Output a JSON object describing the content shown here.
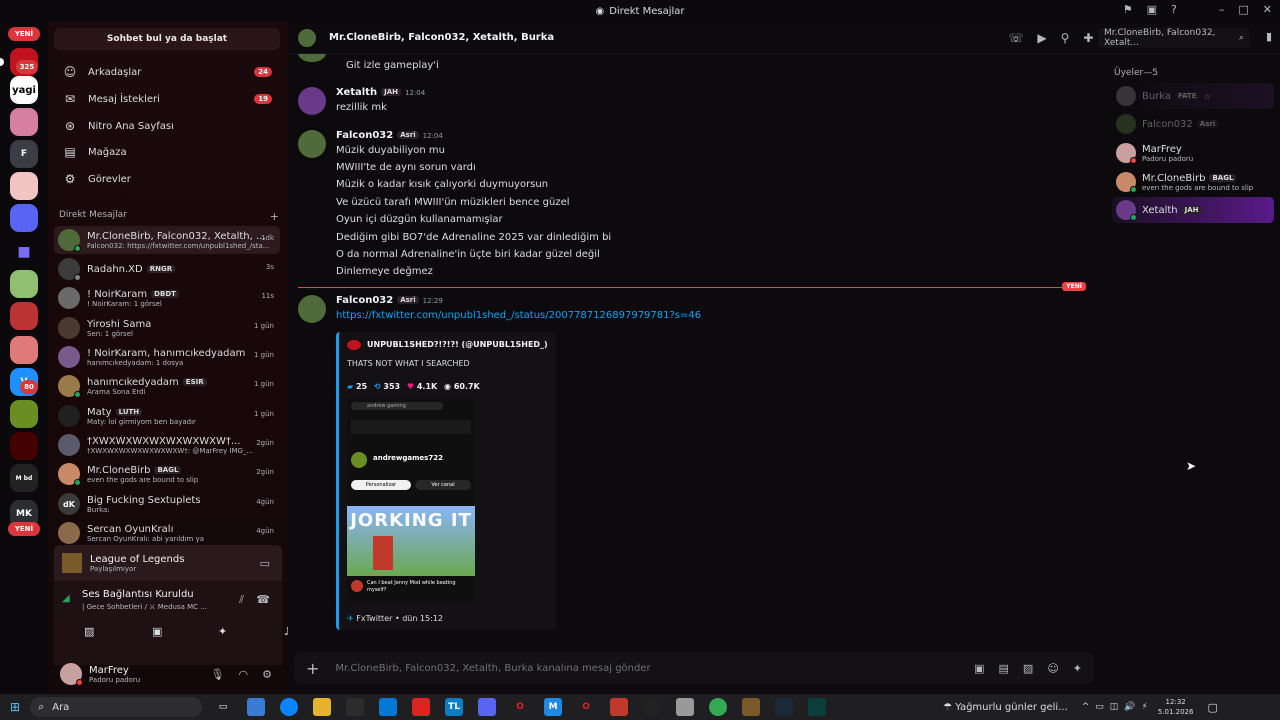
{
  "window": {
    "title": "Direkt Mesajlar"
  },
  "sidebar": {
    "search_label": "Sohbet bul ya da başlat",
    "new_badge_top": "YENİ",
    "new_badge_bottom": "YENİ",
    "server_badges": [
      "325",
      "80"
    ],
    "nav": [
      {
        "label": "Arkadaşlar",
        "badge": "24",
        "icon": "friends-icon"
      },
      {
        "label": "Mesaj İstekleri",
        "badge": "19",
        "icon": "envelope-icon"
      },
      {
        "label": "Nitro Ana Sayfası",
        "badge": "",
        "icon": "nitro-icon"
      },
      {
        "label": "Mağaza",
        "badge": "",
        "icon": "shop-icon"
      },
      {
        "label": "Görevler",
        "badge": "",
        "icon": "quests-icon"
      }
    ],
    "dm_header": "Direkt Mesajlar",
    "dm_add": "+",
    "dms": [
      {
        "name": "Mr.CloneBirb, Falcon032, Xetalth, ...",
        "sub": "Falcon032: https://fxtwitter.com/unpubl1shed_/sta...",
        "time": "1dk",
        "tag": ""
      },
      {
        "name": "Radahn.XD",
        "sub": "",
        "time": "3s",
        "tag": "RNGR"
      },
      {
        "name": "! NoirKaram",
        "sub": "! NoirKaram: 1 görsel",
        "time": "11s",
        "tag": "DBDT"
      },
      {
        "name": "Yiroshi Sama",
        "sub": "Sen: 1 görsel",
        "time": "1 gün",
        "tag": ""
      },
      {
        "name": "! NoirKaram, hanımcıkedyadam",
        "sub": "hanımcıkedyadam: 1 dosya",
        "time": "1 gün",
        "tag": ""
      },
      {
        "name": "hanımcıkedyadam",
        "sub": "Arama Sona Erdi",
        "time": "1 gün",
        "tag": "ESIR"
      },
      {
        "name": "Maty",
        "sub": "Maty: lol girmiyom ben bayadır",
        "time": "1 gün",
        "tag": "LUTH"
      },
      {
        "name": "†XWXWXWXWXWXWXWXW†...",
        "sub": "†XWXWXWXWXWXWXWXW†: @MarFrey IMG_...",
        "time": "2gün",
        "tag": ""
      },
      {
        "name": "Mr.CloneBirb",
        "sub": "even the gods are bound to slip",
        "time": "2gün",
        "tag": "BAGL"
      },
      {
        "name": "Big Fucking Sextuplets",
        "sub": "Burka:",
        "time": "4gün",
        "tag": ""
      },
      {
        "name": "Sercan OyunKralı",
        "sub": "Sercan OyunKralı: abi yarıldım ya",
        "time": "4gün",
        "tag": ""
      }
    ],
    "activity": {
      "title": "League of Legends",
      "sub": "Paylaşılmıyor"
    },
    "voice": {
      "title": "Ses Bağlantısı Kuruldu",
      "sub": "| Gece Sohbetleri / ⚔ Medusa MC ..."
    },
    "user": {
      "name": "MarFrey",
      "status": "Padoru padoru"
    }
  },
  "header": {
    "title": "Mr.CloneBirb, Falcon032, Xetalth, Burka",
    "search_placeholder": "Mr.CloneBirb, Falcon032, Xetalt..."
  },
  "messages": {
    "top_line": "Git izle gameplay'i",
    "m1": {
      "author": "Xetalth",
      "tag": "JAH",
      "time": "12:04",
      "lines": [
        "rezillik mk"
      ]
    },
    "m2": {
      "author": "Falcon032",
      "tag": "Asri",
      "time": "12:04",
      "lines": [
        "Müzik duyabiliyon mu",
        "MWIII'te de aynı sorun vardı",
        "Müzik o kadar kısık çalıyorki duymuyorsun",
        "Ve üzücü tarafı MWIII'ün müzikleri bence güzel",
        "Oyun içi düzgün kullanamamışlar",
        "Dediğim gibi BO7'de Adrenaline 2025 var dinlediğim bi",
        "O da normal Adrenaline'in üçte biri kadar güzel değil",
        "Dinlemeye değmez"
      ]
    },
    "new_label": "YENİ",
    "m3": {
      "author": "Falcon032",
      "tag": "Asri",
      "time": "12:29",
      "link": "https://fxtwitter.com/unpubl1shed_/status/2007787126897979781?s=46"
    },
    "embed": {
      "author": "UNPUBL1SHED?!?!?! (@UNPUBL1SHED_)",
      "text": "THATS NOT WHAT I SEARCHED",
      "stats": {
        "replies": "25",
        "retweets": "353",
        "likes": "4.1K",
        "views": "60.7K"
      },
      "yt_search": "andrew gaming",
      "channel": "andrewgames722",
      "subscribe": "Personalizar",
      "view_channel": "Ver canal",
      "thumb_text": "JORKING IT",
      "video_title": "Can I beat Jenny Mod while beating myself?",
      "footer": "FxTwitter • dün 15:12"
    }
  },
  "composer": {
    "placeholder": "Mr.CloneBirb, Falcon032, Xetalth, Burka kanalına mesaj gönder"
  },
  "members": {
    "header": "Üyeler—5",
    "list": [
      {
        "name": "Burka",
        "tag": "FATE",
        "sub": ""
      },
      {
        "name": "Falcon032",
        "tag": "Asri",
        "sub": ""
      },
      {
        "name": "MarFrey",
        "tag": "",
        "sub": "Padoru padoru"
      },
      {
        "name": "Mr.CloneBirb",
        "tag": "BAGL",
        "sub": "even the gods are bound to slip"
      },
      {
        "name": "Xetalth",
        "tag": "JAH",
        "sub": ""
      }
    ]
  },
  "taskbar": {
    "search": "Ara",
    "weather": "Yağmurlu günler geli...",
    "time": "12:32",
    "date": "5.01.2026"
  },
  "colors": {
    "accent_red": "#da373c",
    "online": "#23a55a",
    "link": "#00a8fc",
    "new_line": "#f23f43"
  }
}
